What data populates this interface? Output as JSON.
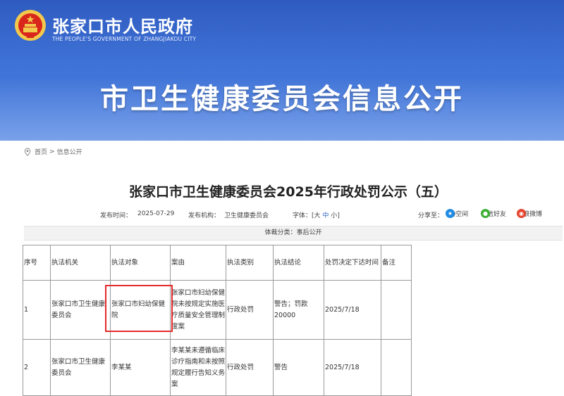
{
  "header": {
    "site_name": "张家口市人民政府",
    "site_name_en": "THE PEOPLE'S GOVERNMENT OF ZHANGJIAKOU CITY",
    "banner_title": "市卫生健康委员会信息公开"
  },
  "breadcrumb": {
    "home": "首页",
    "separator": ">",
    "current": "信息公开"
  },
  "article": {
    "title": "张家口市卫生健康委员会2025年行政处罚公示（五）",
    "publish_label": "发布时间：",
    "publish_date": "2025-07-29",
    "org_label": "发布机构：",
    "org": "卫生健康委员会",
    "font_label": "字体：[",
    "font_large": "大",
    "font_medium": "中",
    "font_small": "小",
    "font_close": "]",
    "share_label": "分享至：",
    "share_qq": "QQ空间",
    "share_wechat": "微信好友",
    "share_weibo": "新浪微博",
    "category": "体裁分类：事后公开"
  },
  "table": {
    "headers": [
      "序号",
      "执法机关",
      "执法对象",
      "案由",
      "执法类别",
      "执法结论",
      "处罚决定下达时间",
      "备注"
    ],
    "rows": [
      [
        "1",
        "张家口市卫生健康委员会",
        "张家口市妇幼保健院",
        "张家口市妇幼保健院未按规定实施医疗质量安全管理制度案",
        "行政处罚",
        "警告；罚款20000",
        "2025/7/18",
        ""
      ],
      [
        "2",
        "张家口市卫生健康委员会",
        "李某某",
        "李某某未遵循临床诊疗指南和未按照规定履行告知义务案",
        "行政处罚",
        "警告",
        "2025/7/18",
        ""
      ]
    ]
  },
  "colors": {
    "banner": "#3f72d6",
    "highlight": "#e52b2b",
    "qq": "#1f8ae3",
    "wechat": "#3cb034",
    "weibo": "#e6432e",
    "font_accent": "#2a62c9"
  }
}
